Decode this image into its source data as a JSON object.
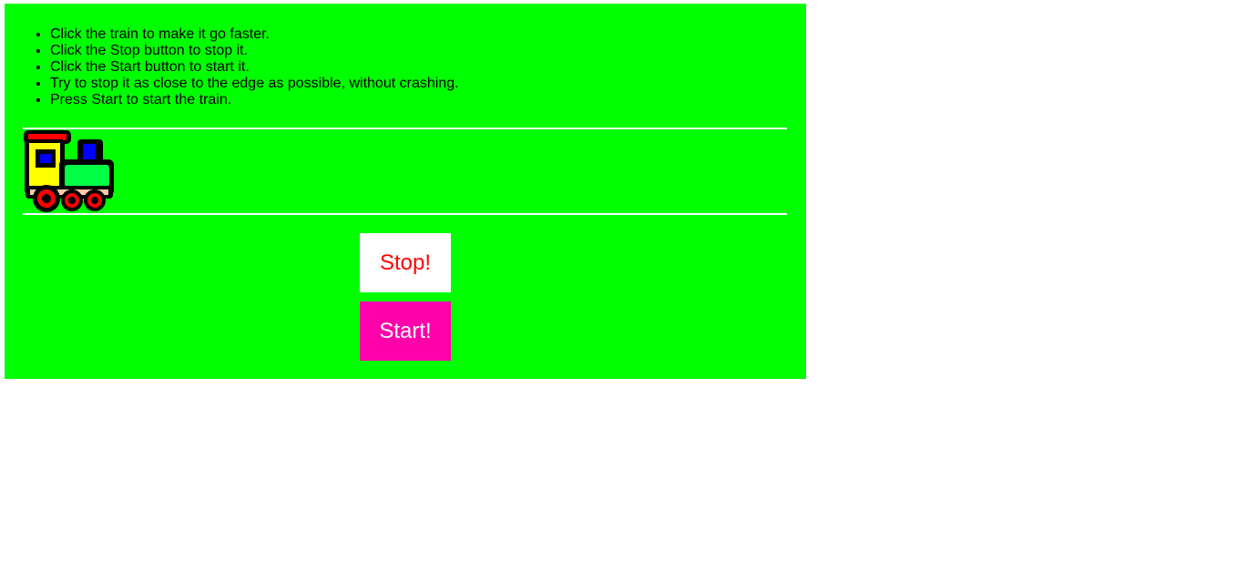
{
  "instructions": [
    "Click the train to make it go faster.",
    "Click the Stop button to stop it.",
    "Click the Start button to start it.",
    "Try to stop it as close to the edge as possible, without crashing.",
    "Press Start to start the train."
  ],
  "buttons": {
    "stop_label": "Stop!",
    "start_label": "Start!"
  },
  "colors": {
    "background": "#00ff00",
    "stop_text": "#ff0000",
    "start_bg": "#ff00aa"
  },
  "train": {
    "icon": "train-icon"
  }
}
